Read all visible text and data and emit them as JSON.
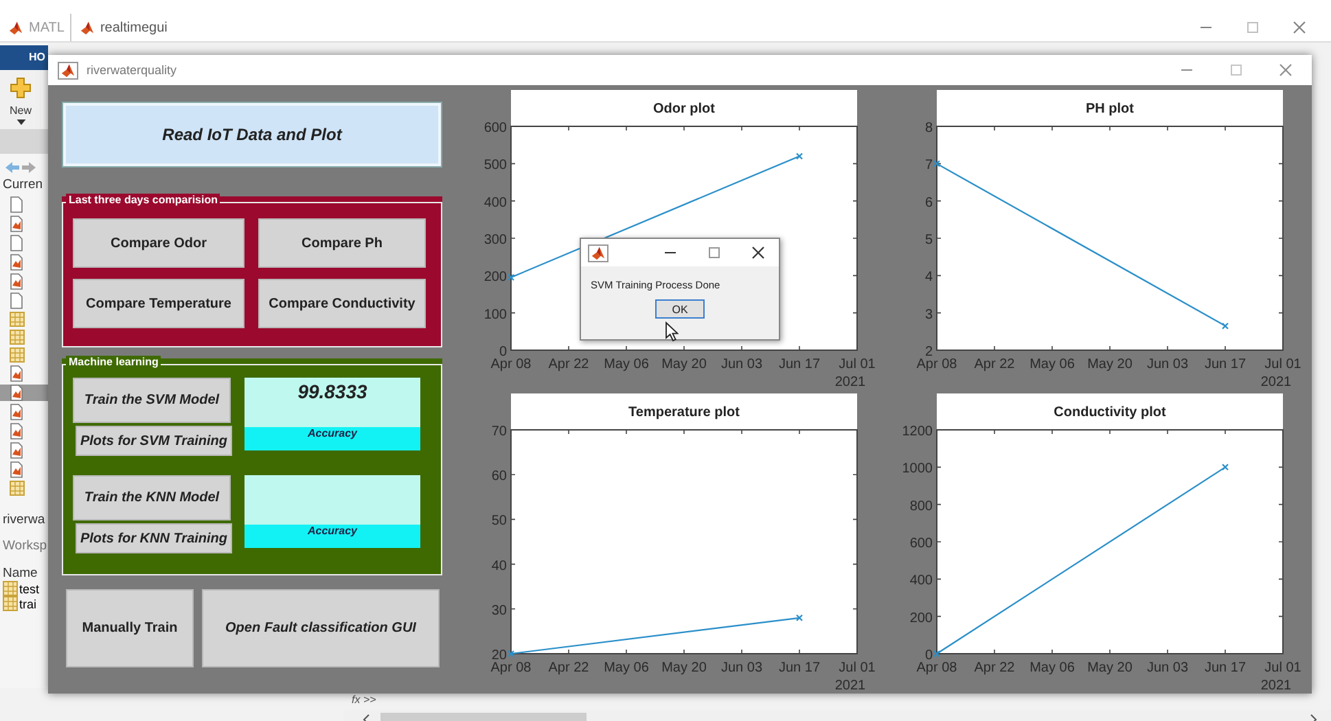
{
  "app_tabs": [
    {
      "label": "MATL",
      "selected": false
    },
    {
      "label": "realtimegui",
      "selected": true
    }
  ],
  "toolstrip": {
    "tab": "HO",
    "new_button": "New"
  },
  "sidebar": {
    "current_folder": "Curren",
    "details": "riverwa",
    "workspace": "Worksp",
    "name_header": "Name",
    "variables": [
      "test",
      "trai"
    ]
  },
  "command_prompt": "fx >>",
  "window": {
    "title": "riverwaterquality"
  },
  "read_button": "Read IoT Data and Plot",
  "comparison_group": {
    "title": "Last three days comparision",
    "buttons": [
      "Compare Odor",
      "Compare Ph",
      "Compare Temperature",
      "Compare Conductivity"
    ]
  },
  "ml_group": {
    "title": "Machine learning",
    "models": [
      {
        "train_button": "Train the SVM Model",
        "plots_button": "Plots for SVM Training",
        "accuracy": "99.8333",
        "accuracy_label": "Accuracy"
      },
      {
        "train_button": "Train the KNN Model",
        "plots_button": "Plots for KNN Training",
        "accuracy_label": "Accuracy"
      }
    ]
  },
  "bottom_buttons": [
    "Manually Train",
    "Open Fault classification GUI"
  ],
  "plots": [
    {
      "year": "2021",
      "chart_data": {
        "type": "line",
        "title": "Odor plot",
        "categories": [
          "Apr 08",
          "Apr 22",
          "May 06",
          "May 20",
          "Jun 03",
          "Jun 17",
          "Jul 01"
        ],
        "series": [
          {
            "color": "#2a8fc9",
            "marker": "x",
            "values": [
              195,
              null,
              null,
              null,
              null,
              520,
              null
            ]
          }
        ],
        "ylim": [
          0,
          600
        ],
        "yticks": [
          0,
          100,
          200,
          300,
          400,
          500,
          600
        ]
      }
    },
    {
      "year": "2021",
      "chart_data": {
        "type": "line",
        "title": "PH plot",
        "categories": [
          "Apr 08",
          "Apr 22",
          "May 06",
          "May 20",
          "Jun 03",
          "Jun 17",
          "Jul 01"
        ],
        "series": [
          {
            "color": "#2a8fc9",
            "marker": "x",
            "values": [
              7,
              null,
              null,
              null,
              null,
              2.65,
              null
            ]
          }
        ],
        "ylim": [
          2,
          8
        ],
        "yticks": [
          2,
          3,
          4,
          5,
          6,
          7,
          8
        ]
      }
    },
    {
      "year": "2021",
      "chart_data": {
        "type": "line",
        "title": "Temperature plot",
        "categories": [
          "Apr 08",
          "Apr 22",
          "May 06",
          "May 20",
          "Jun 03",
          "Jun 17",
          "Jul 01"
        ],
        "series": [
          {
            "color": "#2a8fc9",
            "marker": "x",
            "values": [
              20,
              null,
              null,
              null,
              null,
              28,
              null
            ]
          }
        ],
        "ylim": [
          20,
          70
        ],
        "yticks": [
          20,
          30,
          40,
          50,
          60,
          70
        ]
      }
    },
    {
      "year": "2021",
      "chart_data": {
        "type": "line",
        "title": "Conductivity plot",
        "categories": [
          "Apr 08",
          "Apr 22",
          "May 06",
          "May 20",
          "Jun 03",
          "Jun 17",
          "Jul 01"
        ],
        "series": [
          {
            "color": "#2a8fc9",
            "marker": "x",
            "values": [
              0,
              null,
              null,
              null,
              null,
              1000,
              null
            ]
          }
        ],
        "ylim": [
          0,
          1200
        ],
        "yticks": [
          0,
          200,
          400,
          600,
          800,
          1000,
          1200
        ]
      }
    }
  ],
  "dialog": {
    "message": "SVM Training Process Done",
    "button": "OK"
  }
}
